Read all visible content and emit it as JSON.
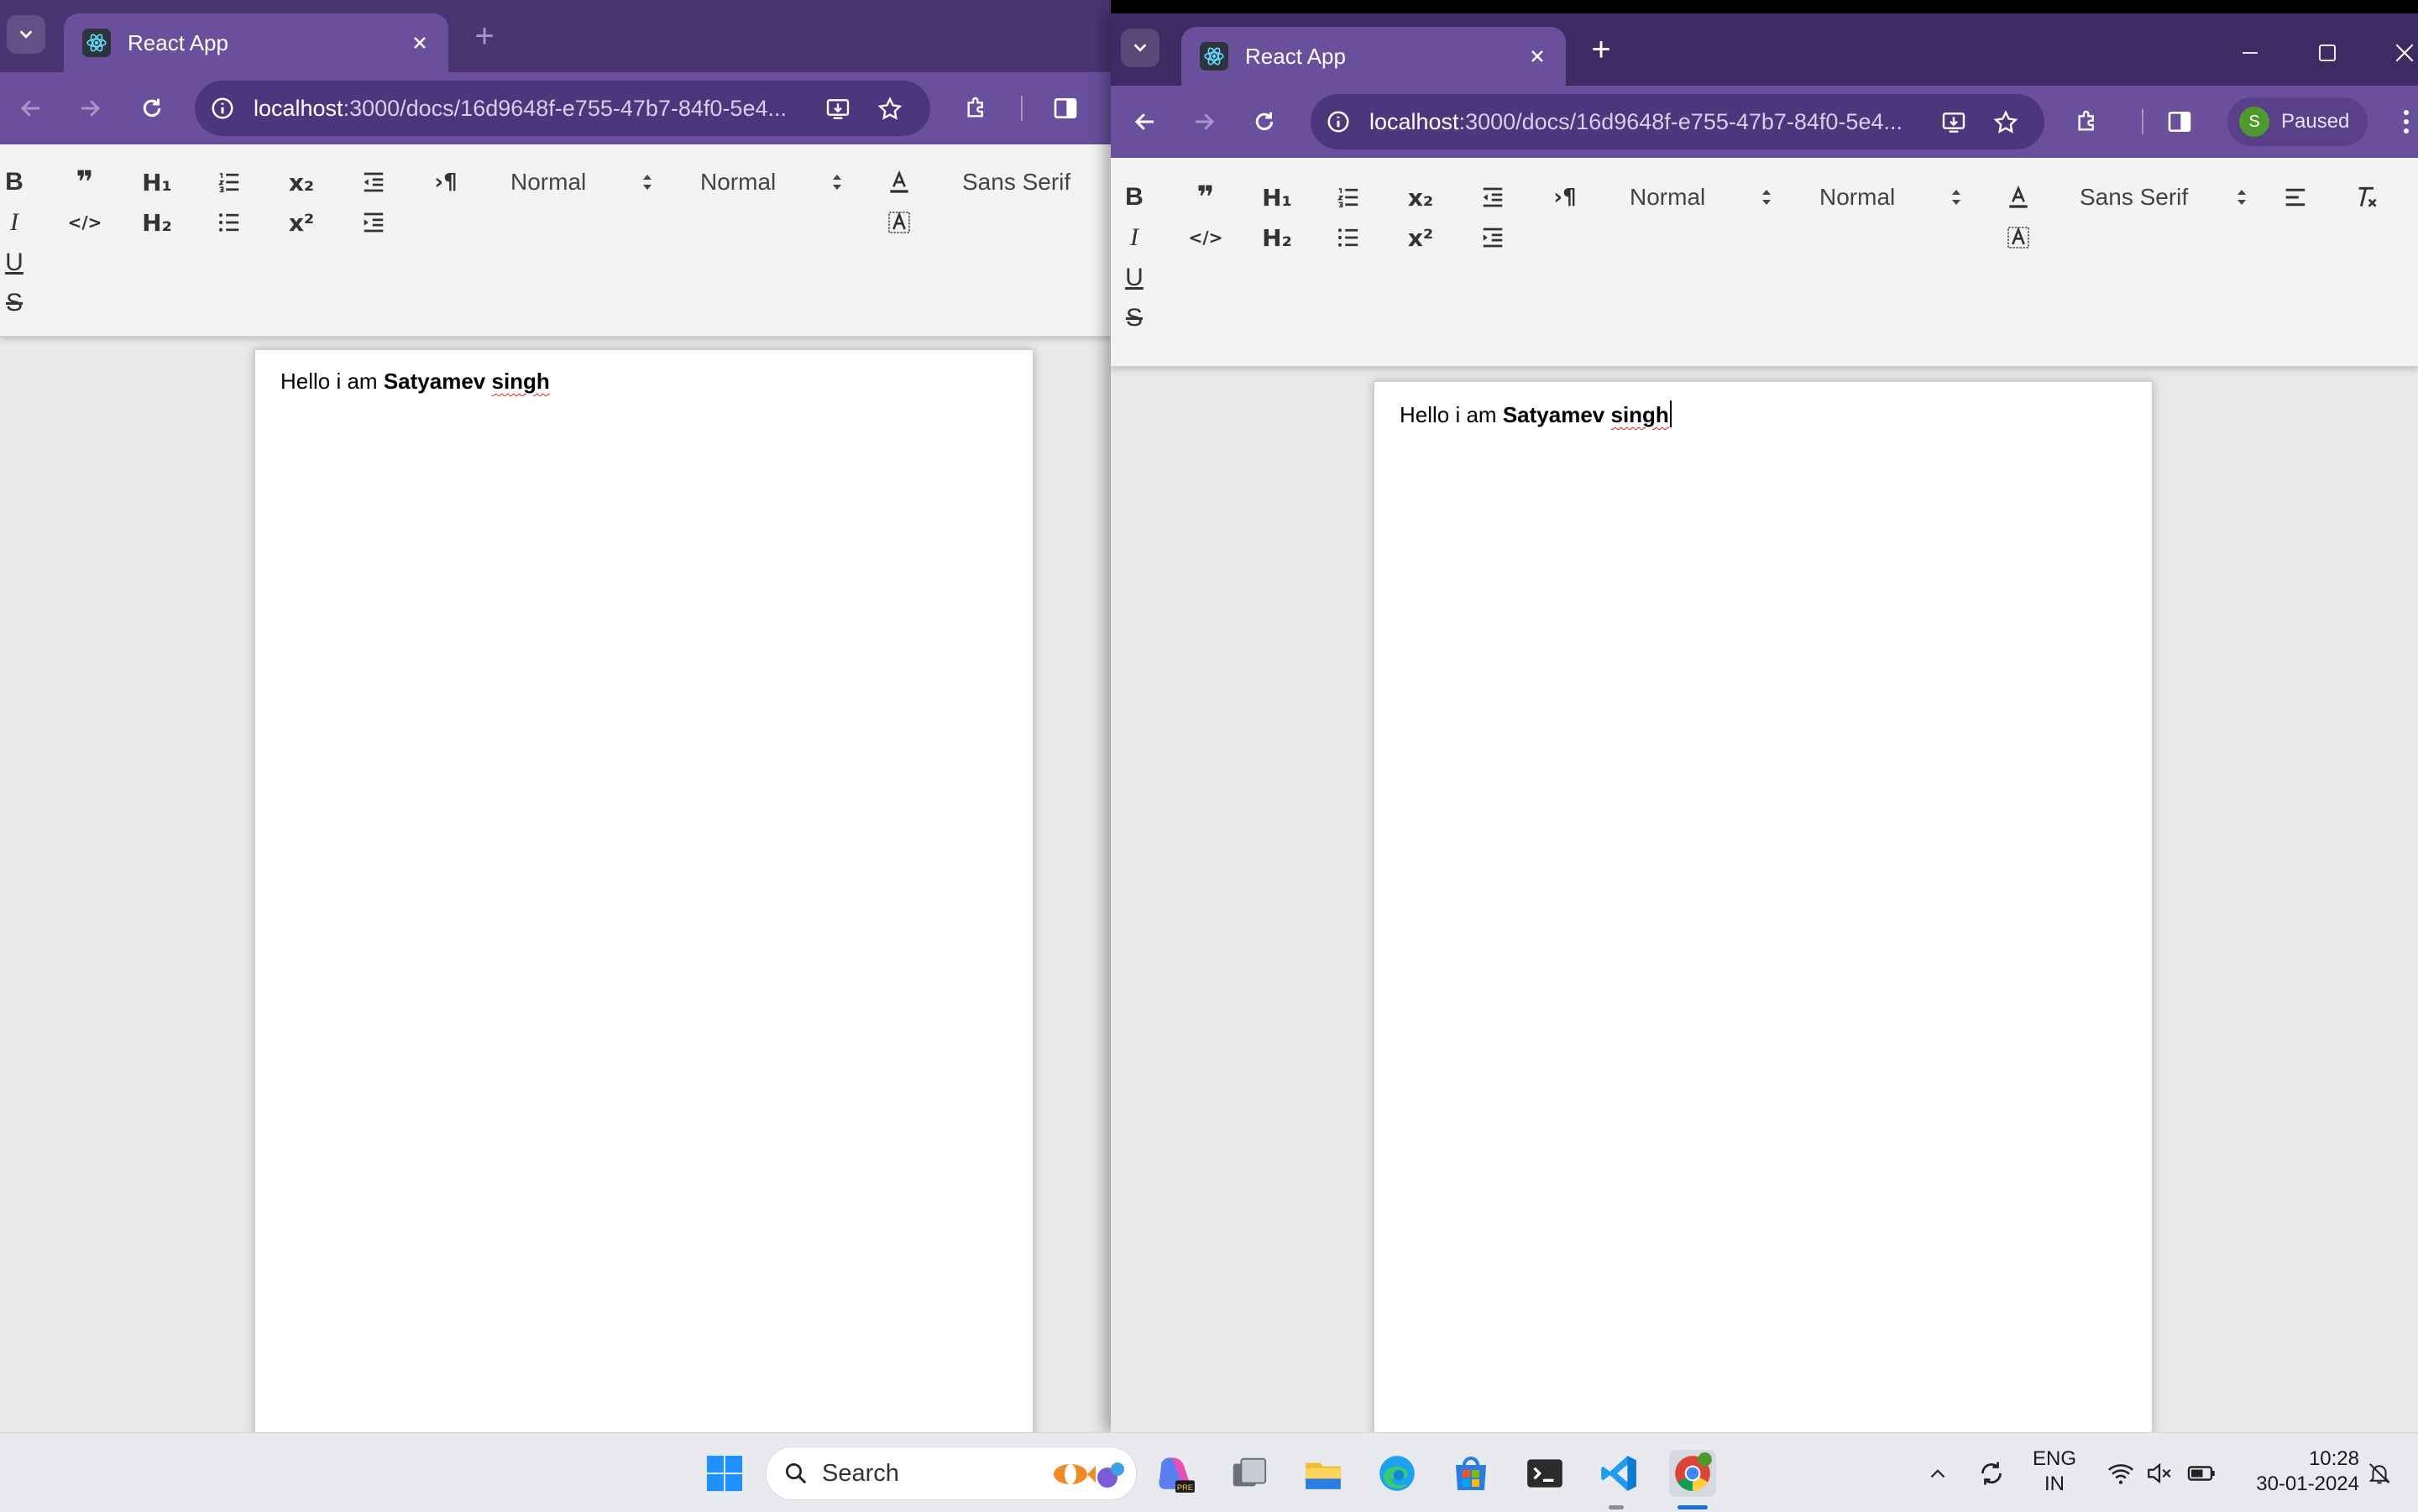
{
  "left_window": {
    "tab_title": "React App",
    "url_host": "localhost",
    "url_rest": ":3000/docs/16d9648f-e755-47b7-84f0-5e4...",
    "header_picker_label": "Normal",
    "size_picker_label": "Normal",
    "font_picker_label": "Sans Serif",
    "doc_text_plain": "Hello i am ",
    "doc_text_bold1": "Satyamev",
    "doc_text_bold2": "singh"
  },
  "right_window": {
    "tab_title": "React App",
    "url_host": "localhost",
    "url_rest": ":3000/docs/16d9648f-e755-47b7-84f0-5e4...",
    "profile_initial": "S",
    "profile_status": "Paused",
    "header_picker_label": "Normal",
    "size_picker_label": "Normal",
    "font_picker_label": "Sans Serif",
    "doc_text_plain": "Hello i am ",
    "doc_text_bold1": "Satyamev",
    "doc_text_bold2": "singh"
  },
  "editor_glyphs": {
    "bold": "B",
    "italic": "I",
    "underline": "U",
    "strike": "S",
    "blockquote": "❞",
    "code": "</>",
    "h1": "H₁",
    "h2": "H₂",
    "subscript": "x₂",
    "superscript": "x²",
    "direction": "›¶"
  },
  "taskbar": {
    "search_label": "Search",
    "lang_line1": "ENG",
    "lang_line2": "IN",
    "time": "10:28",
    "date": "30-01-2024"
  },
  "colors": {
    "browser_frame": "#6a4f9c",
    "tabstrip": "#3f2a63",
    "page_bg": "#e9e9e9",
    "editor_toolbar": "#f3f3f3"
  }
}
